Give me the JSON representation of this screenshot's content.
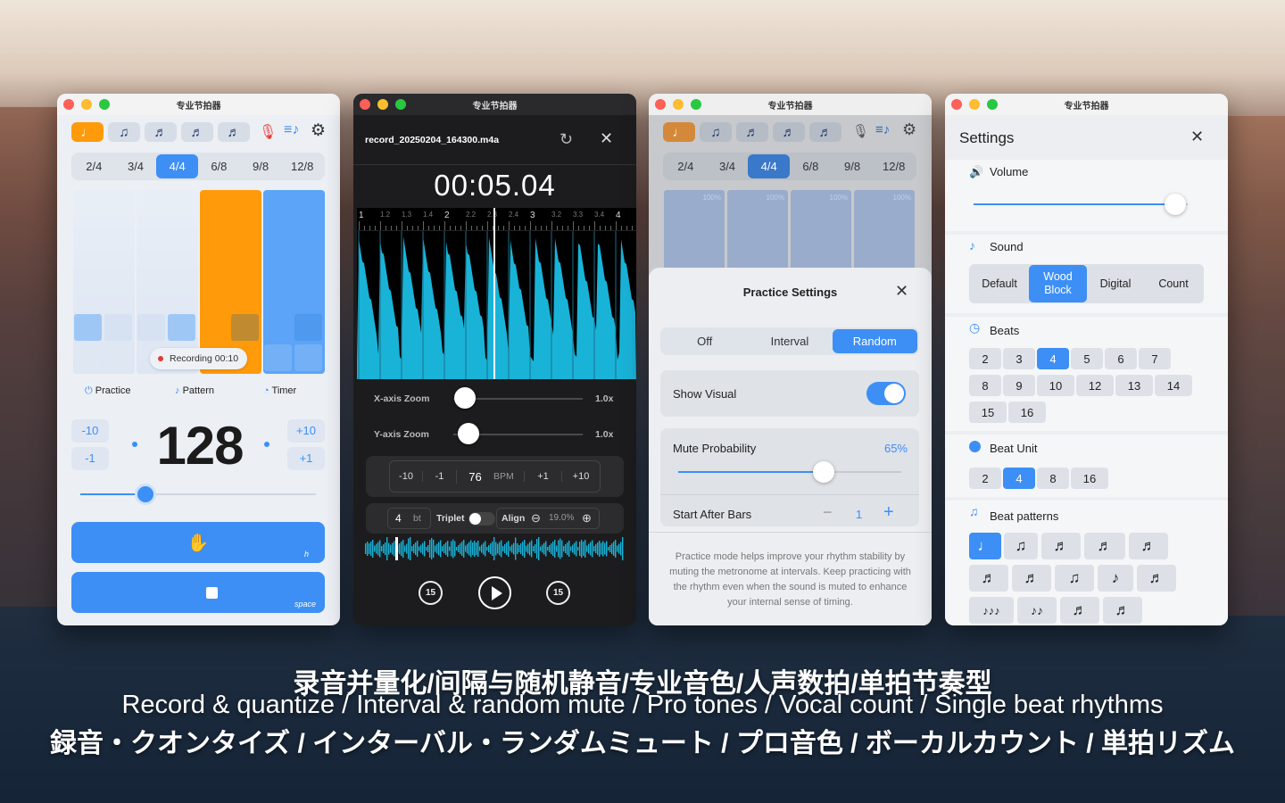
{
  "window_title": "专业节拍器",
  "metronome": {
    "pattern_icons": [
      "♩",
      "♫",
      "♬",
      "♬",
      "♬"
    ],
    "time_signatures": [
      "2/4",
      "3/4",
      "4/4",
      "6/8",
      "9/8",
      "12/8"
    ],
    "selected_time_signature": "4/4",
    "recording_badge": "Recording 00:10",
    "modes": {
      "practice": "Practice",
      "pattern": "Pattern",
      "timer": "Timer"
    },
    "minus10": "-10",
    "minus1": "-1",
    "plus10": "+10",
    "plus1": "+1",
    "bpm": "128",
    "tap_hint": "h",
    "stop_hint": "space",
    "accent_color": "#3d8ff5",
    "active_beat_color": "#ff9a0a"
  },
  "recorder": {
    "file_name": "record_20250204_164300.m4a",
    "time": "00:05.04",
    "ruler_labels": [
      "1",
      "1.2",
      "1.3",
      "1.4",
      "2",
      "2.2",
      "2.3",
      "2.4",
      "3",
      "3.2",
      "3.3",
      "3.4",
      "4"
    ],
    "x_zoom_label": "X-axis Zoom",
    "x_zoom_value": "1.0x",
    "y_zoom_label": "Y-axis Zoom",
    "y_zoom_value": "1.0x",
    "bpm_controls": [
      "-10",
      "-1",
      "76",
      "BPM",
      "+1",
      "+10"
    ],
    "beats": "4",
    "beats_unit": "bt",
    "triplet_label": "Triplet",
    "align_label": "Align",
    "align_value": "19.0%",
    "skip_back": "15",
    "skip_forward": "15",
    "waveform_color": "#19b3d8"
  },
  "practice": {
    "percent_labels": [
      "100%",
      "100%",
      "100%",
      "100%"
    ],
    "title": "Practice Settings",
    "modes": [
      "Off",
      "Interval",
      "Random"
    ],
    "selected_mode": "Random",
    "show_visual_label": "Show Visual",
    "show_visual_on": true,
    "mute_prob_label": "Mute Probability",
    "mute_prob_value": "65%",
    "mute_prob_fraction": 0.65,
    "start_after_label": "Start After Bars",
    "start_after_value": "1",
    "minus": "−",
    "plus": "+",
    "description": "Practice mode helps improve your rhythm stability by muting the metronome at intervals. Keep practicing with the rhythm even when the sound is muted to enhance your internal sense of timing."
  },
  "settings": {
    "title": "Settings",
    "volume_label": "Volume",
    "volume_fraction": 0.94,
    "sound_label": "Sound",
    "sound_options": [
      "Default",
      "Wood Block",
      "Digital",
      "Count"
    ],
    "selected_sound": "Wood Block",
    "beats_label": "Beats",
    "beat_options": [
      "2",
      "3",
      "4",
      "5",
      "6",
      "7",
      "8",
      "9",
      "10",
      "12",
      "13",
      "14",
      "15",
      "16"
    ],
    "selected_beats": "4",
    "beat_unit_label": "Beat Unit",
    "beat_unit_options": [
      "2",
      "4",
      "8",
      "16"
    ],
    "selected_beat_unit": "4",
    "beat_patterns_label": "Beat patterns",
    "pattern_glyphs": [
      "♩",
      "♫",
      "♬",
      "♬",
      "♬",
      "♬",
      "♬",
      "♫",
      "♪",
      "♬",
      "♪♪♪",
      "♪♪",
      "♬",
      "♬"
    ]
  },
  "captions": {
    "chinese": "录音并量化/间隔与随机静音/专业音色/人声数拍/单拍节奏型",
    "english": "Record & quantize / Interval & random mute / Pro tones / Vocal count / Single beat rhythms",
    "japanese": "録音・クオンタイズ / インターバル・ランダムミュート / プロ音色 / ボーカルカウント / 単拍リズム"
  }
}
